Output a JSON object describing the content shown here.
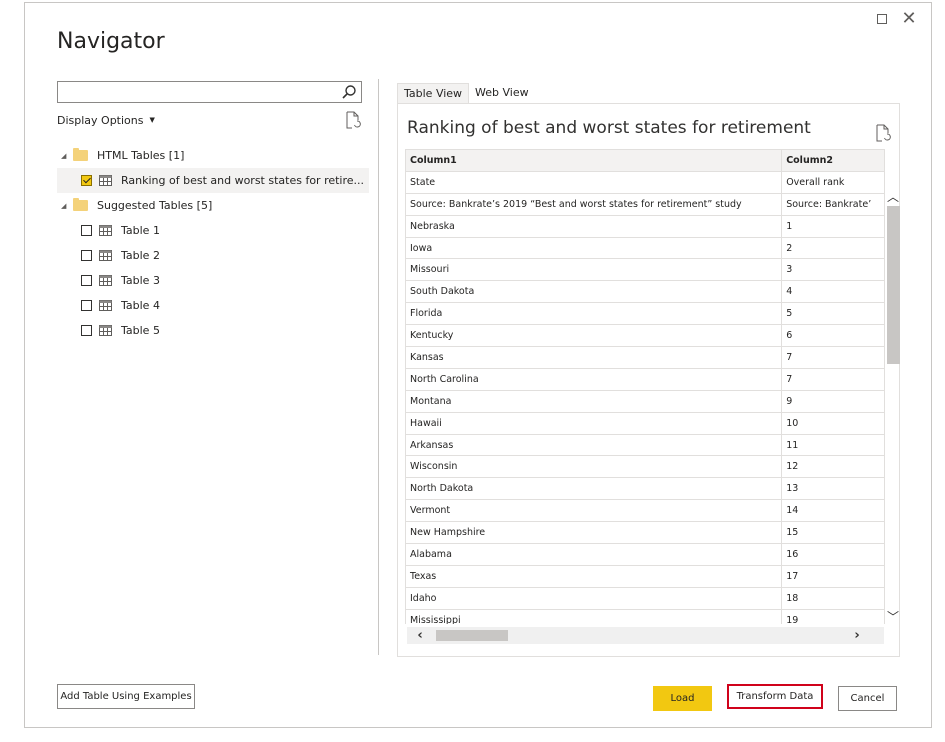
{
  "dialog": {
    "title": "Navigator"
  },
  "left_panel": {
    "search": {
      "value": "",
      "placeholder": ""
    },
    "display_options_label": "Display Options",
    "tree": [
      {
        "kind": "folder",
        "label": "HTML Tables [1]",
        "expanded": true
      },
      {
        "kind": "table",
        "label": "Ranking of best and worst states for retire...",
        "checked": true,
        "selected": true
      },
      {
        "kind": "folder",
        "label": "Suggested Tables [5]",
        "expanded": true
      },
      {
        "kind": "table",
        "label": "Table 1",
        "checked": false
      },
      {
        "kind": "table",
        "label": "Table 2",
        "checked": false
      },
      {
        "kind": "table",
        "label": "Table 3",
        "checked": false
      },
      {
        "kind": "table",
        "label": "Table 4",
        "checked": false
      },
      {
        "kind": "table",
        "label": "Table 5",
        "checked": false
      }
    ]
  },
  "preview": {
    "tabs": [
      {
        "label": "Table View",
        "active": true
      },
      {
        "label": "Web View",
        "active": false
      }
    ],
    "title": "Ranking of best and worst states for retirement",
    "columns": [
      "Column1",
      "Column2"
    ],
    "rows": [
      [
        "State",
        "Overall rank"
      ],
      [
        "Source: Bankrate’s 2019 “Best and worst states for retirement” study",
        "Source: Bankrate’"
      ],
      [
        "Nebraska",
        "1"
      ],
      [
        "Iowa",
        "2"
      ],
      [
        "Missouri",
        "3"
      ],
      [
        "South Dakota",
        "4"
      ],
      [
        "Florida",
        "5"
      ],
      [
        "Kentucky",
        "6"
      ],
      [
        "Kansas",
        "7"
      ],
      [
        "North Carolina",
        "7"
      ],
      [
        "Montana",
        "9"
      ],
      [
        "Hawaii",
        "10"
      ],
      [
        "Arkansas",
        "11"
      ],
      [
        "Wisconsin",
        "12"
      ],
      [
        "North Dakota",
        "13"
      ],
      [
        "Vermont",
        "14"
      ],
      [
        "New Hampshire",
        "15"
      ],
      [
        "Alabama",
        "16"
      ],
      [
        "Texas",
        "17"
      ],
      [
        "Idaho",
        "18"
      ],
      [
        "Mississippi",
        "19"
      ]
    ]
  },
  "buttons": {
    "add_table": "Add Table Using Examples",
    "load": "Load",
    "transform": "Transform Data",
    "cancel": "Cancel"
  },
  "colors": {
    "accent_yellow": "#f2c811",
    "highlight_red": "#d0021b"
  }
}
